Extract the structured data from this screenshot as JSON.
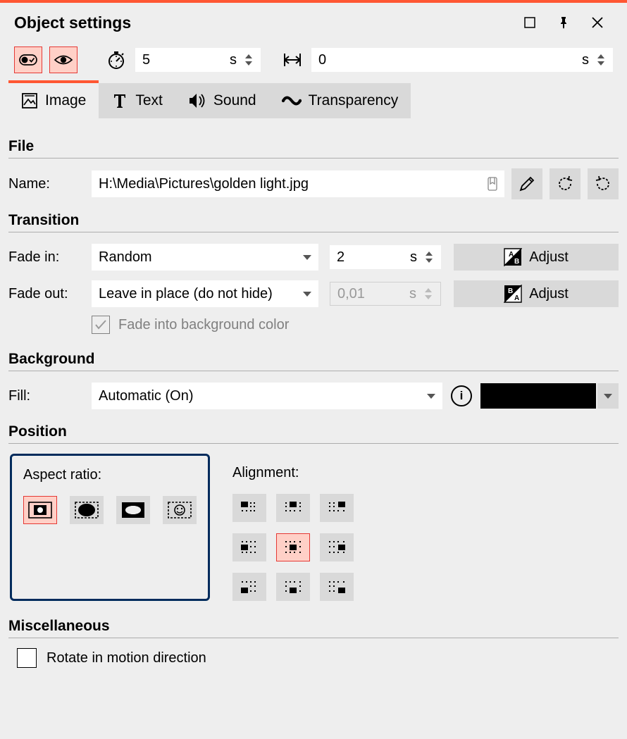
{
  "title": "Object settings",
  "top": {
    "duration": "5",
    "duration_unit": "s",
    "offset": "0",
    "offset_unit": "s"
  },
  "tabs": [
    "Image",
    "Text",
    "Sound",
    "Transparency"
  ],
  "file": {
    "section": "File",
    "name_label": "Name:",
    "name_value": "H:\\Media\\Pictures\\golden light.jpg"
  },
  "transition": {
    "section": "Transition",
    "fadein_label": "Fade in:",
    "fadein_value": "Random",
    "fadein_dur": "2",
    "fadein_unit": "s",
    "fadeout_label": "Fade out:",
    "fadeout_value": "Leave in place (do not hide)",
    "fadeout_dur": "0,01",
    "fadeout_unit": "s",
    "adjust_label": "Adjust",
    "bg_checkbox": "Fade into background colour",
    "bg_checkbox_display": "Fade into background color"
  },
  "background": {
    "section": "Background",
    "fill_label": "Fill:",
    "fill_value": "Automatic (On)",
    "swatch_color": "#000000"
  },
  "position": {
    "section": "Position",
    "aspect_label": "Aspect ratio:",
    "alignment_label": "Alignment:"
  },
  "misc": {
    "section": "Miscellaneous",
    "rotate_label": "Rotate in motion direction"
  }
}
